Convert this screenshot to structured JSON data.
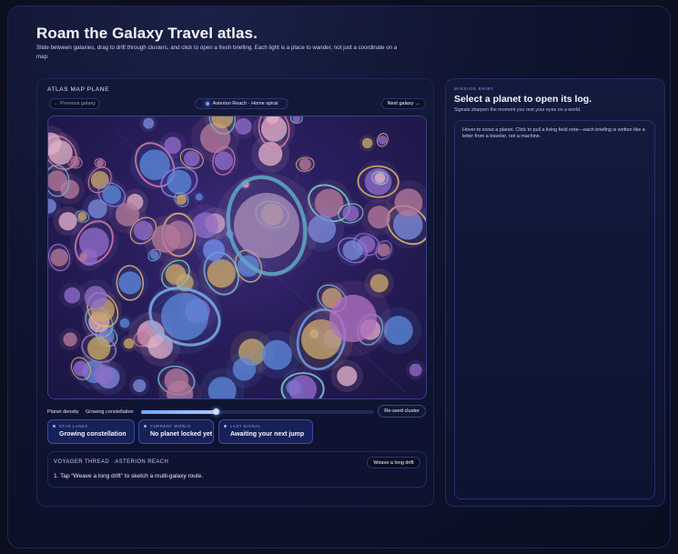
{
  "hero": {
    "title": "Roam the Galaxy Travel atlas.",
    "subtitle": "Slide between galaxies, drag to drift through clusters, and click to open a fresh briefing. Each light is a place to wander, not just a coordinate on a map."
  },
  "atlas": {
    "label": "ATLAS MAP PLANE",
    "prev_label": "← Previous galaxy",
    "next_label": "Next galaxy →",
    "galaxy_pill": "Asterion Reach · Home spiral"
  },
  "density": {
    "label": "Planet density",
    "value_label": "Growing constellation",
    "level": 0.32,
    "reseed_label": "Re-seed cluster"
  },
  "stats": [
    {
      "caption": "STAR LANES",
      "value": "Growing constellation"
    },
    {
      "caption": "CURRENT WORLD",
      "value": "No planet locked yet"
    },
    {
      "caption": "LAST SIGNAL",
      "value": "Awaiting your next jump"
    }
  ],
  "thread": {
    "title": "VOYAGER THREAD · ASTERION REACH",
    "weave_label": "Weave a long drift",
    "step": "1. Tap “Weave a long drift” to sketch a multi-galaxy route."
  },
  "brief": {
    "caption": "MISSION BRIEF",
    "title": "Select a planet to open its log.",
    "subtitle": "Signals sharpen the moment you rest your eyes on a world.",
    "body": "Hover to scout a planet. Click to pull a living field note—each briefing is written like a letter from a traveler, not a machine."
  },
  "colors": {
    "background": "#0b0f1f",
    "panel": "#121838",
    "accent": "#6e9bff",
    "map_glow": "#3c2a78",
    "planet_palette": [
      "#c9a86a",
      "#8f6cc8",
      "#5b86d8",
      "#b4799a",
      "#7a8ad8",
      "#e0b0c8"
    ]
  }
}
